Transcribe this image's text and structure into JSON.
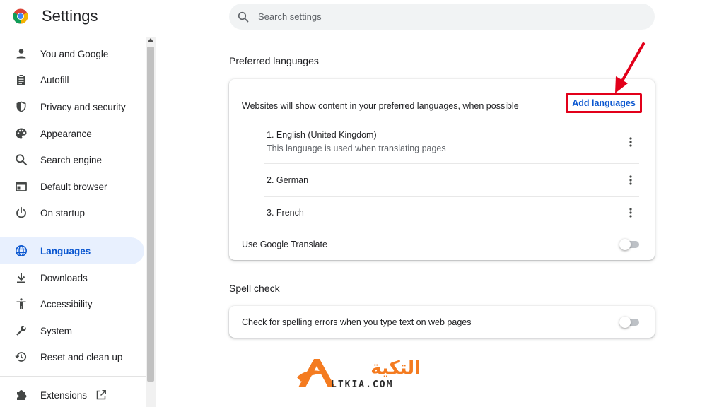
{
  "app": {
    "title": "Settings"
  },
  "search": {
    "placeholder": "Search settings"
  },
  "sidebar": {
    "items": [
      {
        "label": "You and Google",
        "icon": "person-icon",
        "active": false
      },
      {
        "label": "Autofill",
        "icon": "clipboard-icon",
        "active": false
      },
      {
        "label": "Privacy and security",
        "icon": "shield-icon",
        "active": false
      },
      {
        "label": "Appearance",
        "icon": "palette-icon",
        "active": false
      },
      {
        "label": "Search engine",
        "icon": "search-icon",
        "active": false
      },
      {
        "label": "Default browser",
        "icon": "browser-icon",
        "active": false
      },
      {
        "label": "On startup",
        "icon": "power-icon",
        "active": false
      },
      {
        "label": "Languages",
        "icon": "globe-icon",
        "active": true
      },
      {
        "label": "Downloads",
        "icon": "download-icon",
        "active": false
      },
      {
        "label": "Accessibility",
        "icon": "accessibility-icon",
        "active": false
      },
      {
        "label": "System",
        "icon": "wrench-icon",
        "active": false
      },
      {
        "label": "Reset and clean up",
        "icon": "history-icon",
        "active": false
      },
      {
        "label": "Extensions",
        "icon": "puzzle-icon",
        "active": false
      }
    ]
  },
  "languages_section": {
    "title": "Preferred languages",
    "description": "Websites will show content in your preferred languages, when possible",
    "add_button": "Add languages",
    "languages": [
      {
        "label": "1. English (United Kingdom)",
        "note": "This language is used when translating pages"
      },
      {
        "label": "2. German"
      },
      {
        "label": "3. French"
      }
    ],
    "translate_label": "Use Google Translate",
    "translate_enabled": false
  },
  "spell_section": {
    "title": "Spell check",
    "label": "Check for spelling errors when you type text on web pages",
    "enabled": false
  },
  "watermark": {
    "arabic": "التكية",
    "latin": "LTKIA.COM"
  },
  "colors": {
    "accent": "#0b57d0",
    "active_bg": "#e8f0fe",
    "highlight_red": "#e2001a",
    "watermark_orange": "#f47b20",
    "watermark_dark": "#2b2b2b"
  }
}
